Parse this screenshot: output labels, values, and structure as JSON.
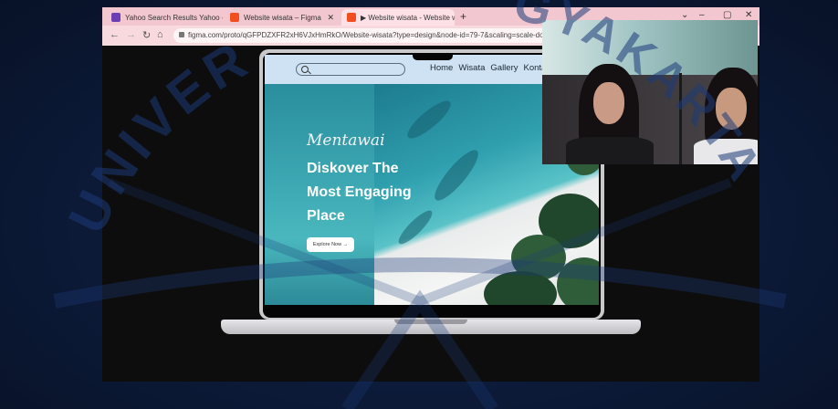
{
  "browser": {
    "tabs": [
      {
        "title": "Yahoo Search Results Yahoo - Cc",
        "favicon_color": "#6b3fb3",
        "active": false
      },
      {
        "title": "Website wisata – Figma",
        "favicon_color": "#f24e1e",
        "active": false
      },
      {
        "title": "▶ Website wisata - Website wisa",
        "favicon_color": "#f24e1e",
        "active": true
      }
    ],
    "new_tab_label": "+",
    "address": "figma.com/proto/qGFPDZXFR2xH6VJxHmRkO/Website-wisata?type=design&node-id=79-7&scaling=scale-down&pag"
  },
  "site": {
    "search_placeholder": "",
    "nav_links": [
      "Home",
      "Wisata",
      "Gallery",
      "Konta"
    ],
    "script_title": "Mentawai",
    "headline_lines": [
      "Diskover The",
      "Most Engaging",
      "Place"
    ],
    "cta_label": "Explore Now →"
  },
  "watermark": {
    "text": "UNIVERSITAS ... YOGYAKARTA",
    "visible_left": "UNIVER",
    "visible_right": "GYAKARTA"
  },
  "colors": {
    "tab_bar": "#f2c7cf",
    "site_nav": "#cfe2f3",
    "hero_teal": "#2a8e9d",
    "watermark": "#1c3a78"
  }
}
